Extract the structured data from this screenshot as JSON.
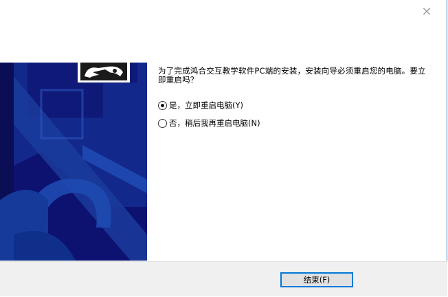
{
  "window": {
    "close_glyph": "✕"
  },
  "dialog": {
    "prompt": "为了完成鸿合交互教学软件PC端的安装，安装向导必须重启您的电脑。要立即重启吗？"
  },
  "options": [
    {
      "label": "是，立即重启电脑(Y)",
      "selected": true
    },
    {
      "label": "否，稍后我再重启电脑(N)",
      "selected": false
    }
  ],
  "buttons": {
    "finish": "结束(F)"
  },
  "colors": {
    "banner": "#0d1270",
    "banner_accent": "#1b3c9c",
    "button_focus": "#0078d7"
  },
  "icons": {
    "logo": "installer-logo-icon",
    "close": "close-icon"
  }
}
